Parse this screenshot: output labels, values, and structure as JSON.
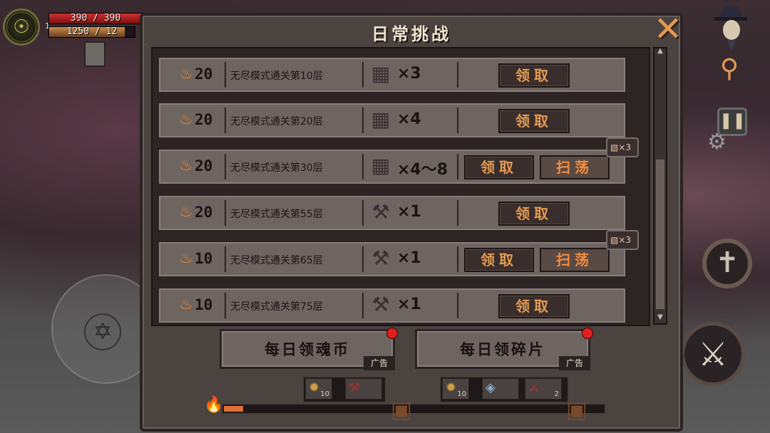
{
  "hud": {
    "hp_text": "390 / 390",
    "mp_text": "1250 / 12",
    "level": "1"
  },
  "panel": {
    "title": "日常挑战",
    "close_label": "✕"
  },
  "rows": [
    {
      "points": "20",
      "desc": "无尽模式通关第10层",
      "qty": "×3",
      "claim": "领取",
      "sweep": null,
      "sweep_count": null
    },
    {
      "points": "20",
      "desc": "无尽模式通关第20层",
      "qty": "×4",
      "claim": "领取",
      "sweep": null,
      "sweep_count": null
    },
    {
      "points": "20",
      "desc": "无尽模式通关第30层",
      "qty": "×4～8",
      "claim": "领取",
      "sweep": "扫荡",
      "sweep_count": "×3"
    },
    {
      "points": "20",
      "desc": "无尽模式通关第55层",
      "qty": "×1",
      "claim": "领取",
      "sweep": null,
      "sweep_count": null
    },
    {
      "points": "10",
      "desc": "无尽模式通关第65层",
      "qty": "×1",
      "claim": "领取",
      "sweep": "扫荡",
      "sweep_count": "×3"
    },
    {
      "points": "10",
      "desc": "无尽模式通关第75层",
      "qty": "×1",
      "claim": "领取",
      "sweep": null,
      "sweep_count": null
    }
  ],
  "bottom": {
    "daily_coin_label": "每日领魂币",
    "daily_shard_label": "每日领碎片",
    "ad_label": "广告",
    "left_rewards": [
      {
        "count": "10"
      },
      {
        "count": ""
      }
    ],
    "right_rewards": [
      {
        "count": "10"
      },
      {
        "count": ""
      },
      {
        "count": "2"
      }
    ],
    "progress": 0.05
  },
  "colors": {
    "accent": "#e39a52",
    "panel": "#4a433f",
    "row": "#6e6460"
  }
}
